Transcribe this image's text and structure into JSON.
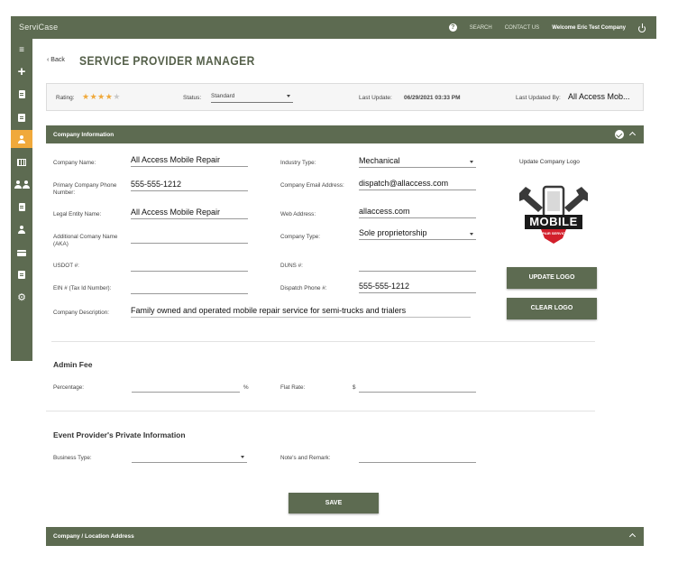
{
  "app": {
    "brand": "ServiCase"
  },
  "topnav": {
    "search": "SEARCH",
    "contact": "CONTACT US",
    "welcome": "Welcome Eric Test Company"
  },
  "sidebar": {
    "icons": [
      "menu-icon",
      "plus-icon",
      "document-icon",
      "certificate-icon",
      "user-icon",
      "calendar-icon",
      "users-icon",
      "billing-icon",
      "user-settings-icon",
      "card-icon",
      "notebook-icon",
      "gear-icon"
    ],
    "active": "user-icon"
  },
  "header": {
    "back_label": "Back",
    "title": "SERVICE PROVIDER MANAGER"
  },
  "info_bar": {
    "rating_label": "Rating:",
    "rating": 4,
    "rating_max": 5,
    "status_label": "Status:",
    "status_value": "Standard",
    "last_update_label": "Last Update:",
    "last_update_value": "06/29/2021 03:33 PM",
    "last_updated_by_label": "Last Updated By:",
    "last_updated_by_value": "All Access Mob..."
  },
  "company_info": {
    "title": "Company Information",
    "fields": {
      "company_name": {
        "label": "Company Name:",
        "value": "All Access Mobile Repair"
      },
      "primary_phone": {
        "label": "Primary Company Phone Number:",
        "value": "555-555-1212"
      },
      "legal_entity": {
        "label": "Legal Entity Name:",
        "value": "All Access Mobile Repair"
      },
      "aka": {
        "label": "Additional Comany Name (AKA)",
        "value": ""
      },
      "usdot": {
        "label": "USDOT #:",
        "value": ""
      },
      "ein": {
        "label": "EIN # (Tax Id Number):",
        "value": ""
      },
      "description": {
        "label": "Company Description:",
        "value": "Family owned and operated mobile repair service for semi-trucks and trialers"
      },
      "industry_type": {
        "label": "Industry Type:",
        "value": "Mechanical"
      },
      "email": {
        "label": "Company Email Address:",
        "value": "dispatch@allaccess.com"
      },
      "web": {
        "label": "Web Address:",
        "value": "allaccess.com"
      },
      "company_type": {
        "label": "Company Type:",
        "value": "Sole proprietorship"
      },
      "duns": {
        "label": "DUNS #:",
        "value": ""
      },
      "dispatch_phone": {
        "label": "Dispatch Phone #:",
        "value": "555-555-1212"
      }
    },
    "logo": {
      "update_label": "Update Company Logo",
      "word": "MOBILE",
      "tagline": "REPAIR SERVICES",
      "update_button": "UPDATE LOGO",
      "clear_button": "CLEAR LOGO"
    }
  },
  "admin_fee": {
    "title": "Admin Fee",
    "percentage_label": "Percentage:",
    "percentage_unit": "%",
    "flat_rate_label": "Flat Rate:",
    "flat_rate_unit": "$"
  },
  "private_info": {
    "title": "Event Provider's Private Information",
    "business_type_label": "Business Type:",
    "notes_label": "Note's and Remark:"
  },
  "save_button": "SAVE",
  "location_section": {
    "title": "Company / Location Address"
  },
  "colors": {
    "primary": "#5d6b51",
    "accent": "#f0a93b",
    "logo_red": "#d21f2b"
  }
}
